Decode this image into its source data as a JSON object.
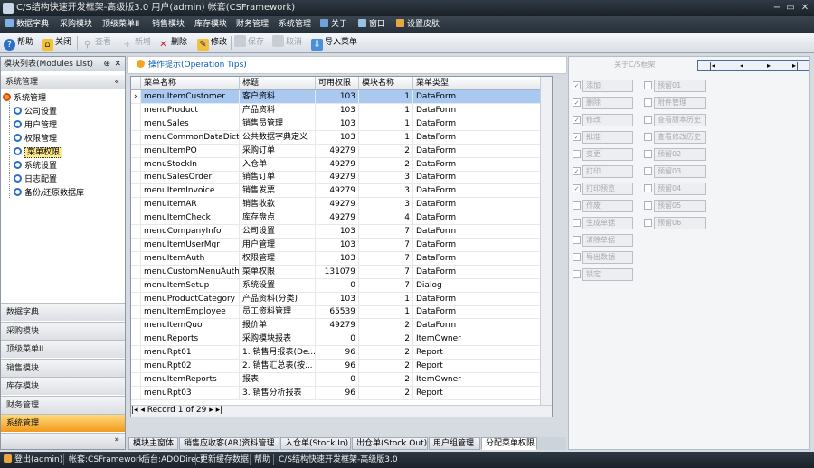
{
  "window": {
    "title": "C/S结构快速开发框架-高级版3.0 用户(admin) 帐套(CSFramework)",
    "buttons": [
      "−",
      "▭",
      "✕"
    ]
  },
  "menubar": {
    "items": [
      "数据字典",
      "采购模块",
      "顶级菜单II",
      "销售模块",
      "库存模块",
      "财务管理",
      "系统管理",
      "关于",
      "窗口",
      "设置皮肤"
    ]
  },
  "toolbar": {
    "help": "帮助",
    "close": "关闭",
    "view": "查看",
    "add": "新增",
    "delete": "删除",
    "edit": "修改",
    "save": "保存",
    "cancel": "取消",
    "import_menu": "导入菜单"
  },
  "left_panel": {
    "header": "模块列表(Modules List)",
    "pin": "⊕",
    "close": "✕",
    "group_title": "系统管理",
    "collapse": "«",
    "tree": {
      "root": "系统管理",
      "children": [
        "公司设置",
        "用户管理",
        "权限管理",
        "菜单权限",
        "系统设置",
        "日志配置",
        "备份/还原数据库"
      ]
    },
    "nav_groups": [
      "数据字典",
      "采购模块",
      "顶级菜单II",
      "销售模块",
      "库存模块",
      "财务管理",
      "系统管理"
    ],
    "footer_chevron": "»"
  },
  "tips": {
    "label": "操作提示(Operation Tips)"
  },
  "grid": {
    "columns": [
      "菜单名称",
      "标题",
      "可用权限",
      "模块名称",
      "菜单类型"
    ],
    "rows": [
      [
        "menuItemCustomer",
        "客户资料",
        "103",
        "1",
        "DataForm"
      ],
      [
        "menuProduct",
        "产品资料",
        "103",
        "1",
        "DataForm"
      ],
      [
        "menuSales",
        "销售员管理",
        "103",
        "1",
        "DataForm"
      ],
      [
        "menuCommonDataDict",
        "公共数据字典定义",
        "103",
        "1",
        "DataForm"
      ],
      [
        "menuItemPO",
        "采购订单",
        "49279",
        "2",
        "DataForm"
      ],
      [
        "menuStockIn",
        "入仓单",
        "49279",
        "2",
        "DataForm"
      ],
      [
        "menuSalesOrder",
        "销售订单",
        "49279",
        "3",
        "DataForm"
      ],
      [
        "menuItemInvoice",
        "销售发票",
        "49279",
        "3",
        "DataForm"
      ],
      [
        "menuItemAR",
        "销售收款",
        "49279",
        "3",
        "DataForm"
      ],
      [
        "menuItemCheck",
        "库存盘点",
        "49279",
        "4",
        "DataForm"
      ],
      [
        "menuCompanyInfo",
        "公司设置",
        "103",
        "7",
        "DataForm"
      ],
      [
        "menuItemUserMgr",
        "用户管理",
        "103",
        "7",
        "DataForm"
      ],
      [
        "menuItemAuth",
        "权限管理",
        "103",
        "7",
        "DataForm"
      ],
      [
        "menuCustomMenuAuth",
        "菜单权限",
        "131079",
        "7",
        "DataForm"
      ],
      [
        "menuItemSetup",
        "系统设置",
        "0",
        "7",
        "Dialog"
      ],
      [
        "menuProductCategory",
        "产品资料(分类)",
        "103",
        "1",
        "DataForm"
      ],
      [
        "menuItemEmployee",
        "员工资料管理",
        "65539",
        "1",
        "DataForm"
      ],
      [
        "menuItemQuo",
        "报价单",
        "49279",
        "2",
        "DataForm"
      ],
      [
        "menuReports",
        "采购模块报表",
        "0",
        "2",
        "ItemOwner"
      ],
      [
        "menuRpt01",
        "1. 销售月报表(De...",
        "96",
        "2",
        "Report"
      ],
      [
        "menuRpt02",
        "2. 销售汇总表(按...",
        "96",
        "2",
        "Report"
      ],
      [
        "menuItemReports",
        "报表",
        "0",
        "2",
        "ItemOwner"
      ],
      [
        "menuRpt03",
        "3. 销售分析报表",
        "96",
        "2",
        "Report"
      ]
    ],
    "record_label": "Record 1 of 29",
    "row_pointer": "›"
  },
  "right_panel": {
    "title": "关于C/S框架",
    "pager": [
      "|◂",
      "◂",
      "▸",
      "▸|"
    ],
    "left_ops": [
      "添加",
      "删除",
      "修改",
      "批准",
      "变更",
      "打印",
      "打印预览",
      "作废",
      "生成单据",
      "清除单据",
      "导出数据",
      "锁定"
    ],
    "left_checked": [
      true,
      true,
      true,
      true,
      false,
      true,
      true,
      false,
      false,
      false,
      false,
      false
    ],
    "right_ops": [
      "预留01",
      "附件管理",
      "查看版本历史",
      "查看修改历史",
      "预留02",
      "预留03",
      "预留04",
      "预留05",
      "预留06"
    ],
    "right_checked": [
      false,
      false,
      false,
      false,
      false,
      false,
      false,
      false,
      false
    ]
  },
  "bottom_tabs": {
    "items": [
      "模块主窗体",
      "销售应收客(AR)资料管理",
      "入仓单(Stock In)",
      "出仓单(Stock Out)",
      "用户组管理",
      "分配菜单权限"
    ],
    "active_index": 5
  },
  "statusbar": {
    "logout": "登出(admin)",
    "account": "帐套:CSFramework",
    "backend": "后台:ADODirect",
    "update_cache": "更新缓存数据",
    "help": "帮助",
    "product": "C/S结构快速开发框架-高级版3.0"
  }
}
